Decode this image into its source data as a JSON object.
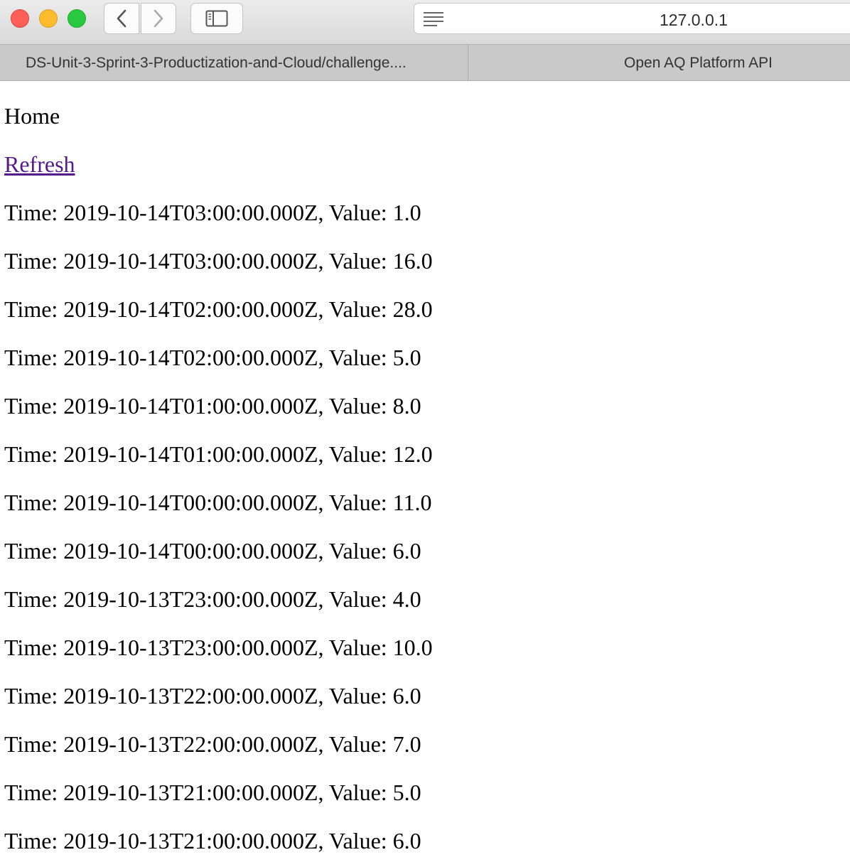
{
  "browser": {
    "url": "127.0.0.1",
    "tabs": [
      {
        "label": "DS-Unit-3-Sprint-3-Productization-and-Cloud/challenge...."
      },
      {
        "label": "Open AQ Platform API"
      }
    ],
    "icons": {
      "back": "chevron-left-icon",
      "forward": "chevron-right-icon",
      "sidebar": "sidebar-icon",
      "reader": "reader-icon"
    }
  },
  "page": {
    "heading": "Home",
    "refresh_label": "Refresh",
    "records": [
      "Time: 2019-10-14T03:00:00.000Z, Value: 1.0",
      "Time: 2019-10-14T03:00:00.000Z, Value: 16.0",
      "Time: 2019-10-14T02:00:00.000Z, Value: 28.0",
      "Time: 2019-10-14T02:00:00.000Z, Value: 5.0",
      "Time: 2019-10-14T01:00:00.000Z, Value: 8.0",
      "Time: 2019-10-14T01:00:00.000Z, Value: 12.0",
      "Time: 2019-10-14T00:00:00.000Z, Value: 11.0",
      "Time: 2019-10-14T00:00:00.000Z, Value: 6.0",
      "Time: 2019-10-13T23:00:00.000Z, Value: 4.0",
      "Time: 2019-10-13T23:00:00.000Z, Value: 10.0",
      "Time: 2019-10-13T22:00:00.000Z, Value: 6.0",
      "Time: 2019-10-13T22:00:00.000Z, Value: 7.0",
      "Time: 2019-10-13T21:00:00.000Z, Value: 5.0",
      "Time: 2019-10-13T21:00:00.000Z, Value: 6.0"
    ]
  },
  "colors": {
    "link": "#551a8b",
    "close": "#fe5f57",
    "minimize": "#febc2e",
    "zoom": "#28c840"
  }
}
